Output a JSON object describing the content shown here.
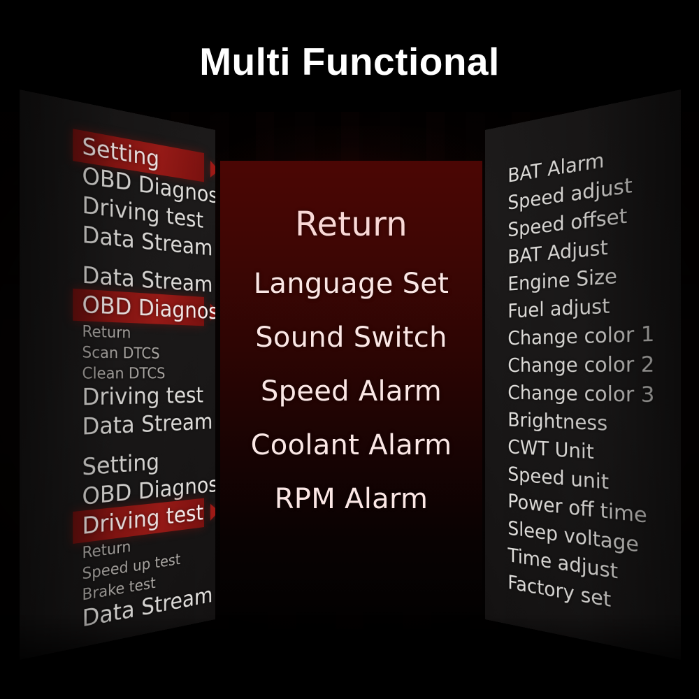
{
  "header": {
    "title": "Multi Functional"
  },
  "colors": {
    "background": "#050202",
    "panel_side": "#1c1a1a",
    "panel_center_top": "#4b0604",
    "panel_center_bottom": "#030101",
    "highlight_red": "#9d1a16",
    "text_primary": "#e9e7e4",
    "text_secondary": "#b9b5b1",
    "text_center": "#fbe7e5",
    "title_color": "#ffffff"
  },
  "left_panel": {
    "name": "main-menu-screens",
    "items": [
      {
        "label": "Setting",
        "size": "large",
        "highlighted": true,
        "arrow": true
      },
      {
        "label": "OBD Diagnose",
        "size": "large",
        "highlighted": false,
        "arrow": false
      },
      {
        "label": "Driving test",
        "size": "large",
        "highlighted": false,
        "arrow": false
      },
      {
        "label": "Data Stream",
        "size": "large",
        "highlighted": false,
        "arrow": false
      },
      {
        "label": "Data Stream",
        "size": "large",
        "highlighted": false,
        "arrow": false
      },
      {
        "label": "OBD Diagnose",
        "size": "large",
        "highlighted": true,
        "arrow": true
      },
      {
        "label": "Return",
        "size": "small",
        "highlighted": false,
        "arrow": false
      },
      {
        "label": "Scan DTCS",
        "size": "small",
        "highlighted": false,
        "arrow": false
      },
      {
        "label": "Clean DTCS",
        "size": "small",
        "highlighted": false,
        "arrow": false
      },
      {
        "label": "Driving test",
        "size": "large",
        "highlighted": false,
        "arrow": false
      },
      {
        "label": "Data Stream",
        "size": "large",
        "highlighted": false,
        "arrow": false
      },
      {
        "label": "Setting",
        "size": "large",
        "highlighted": false,
        "arrow": false
      },
      {
        "label": "OBD Diagnose",
        "size": "large",
        "highlighted": false,
        "arrow": false
      },
      {
        "label": "Driving test",
        "size": "large",
        "highlighted": true,
        "arrow": true
      },
      {
        "label": "Return",
        "size": "small",
        "highlighted": false,
        "arrow": false
      },
      {
        "label": "Speed up test",
        "size": "small",
        "highlighted": false,
        "arrow": false
      },
      {
        "label": "Brake test",
        "size": "small",
        "highlighted": false,
        "arrow": false
      },
      {
        "label": "Data Stream",
        "size": "large",
        "highlighted": false,
        "arrow": false
      }
    ]
  },
  "center_panel": {
    "name": "settings-menu-screen",
    "items": [
      {
        "label": "Return"
      },
      {
        "label": "Language Set"
      },
      {
        "label": "Sound Switch"
      },
      {
        "label": "Speed Alarm"
      },
      {
        "label": "Coolant Alarm"
      },
      {
        "label": "RPM Alarm"
      }
    ]
  },
  "right_panel": {
    "name": "settings-options-list",
    "items": [
      {
        "label": "BAT Alarm"
      },
      {
        "label": "Speed adjust"
      },
      {
        "label": "Speed offset"
      },
      {
        "label": "BAT Adjust"
      },
      {
        "label": "Engine Size"
      },
      {
        "label": "Fuel adjust"
      },
      {
        "label": "Change color 1"
      },
      {
        "label": "Change color 2"
      },
      {
        "label": "Change color 3"
      },
      {
        "label": "Brightness"
      },
      {
        "label": "CWT Unit"
      },
      {
        "label": "Speed unit"
      },
      {
        "label": "Power off time"
      },
      {
        "label": "Sleep voltage"
      },
      {
        "label": "Time adjust"
      },
      {
        "label": "Factory set"
      }
    ]
  }
}
